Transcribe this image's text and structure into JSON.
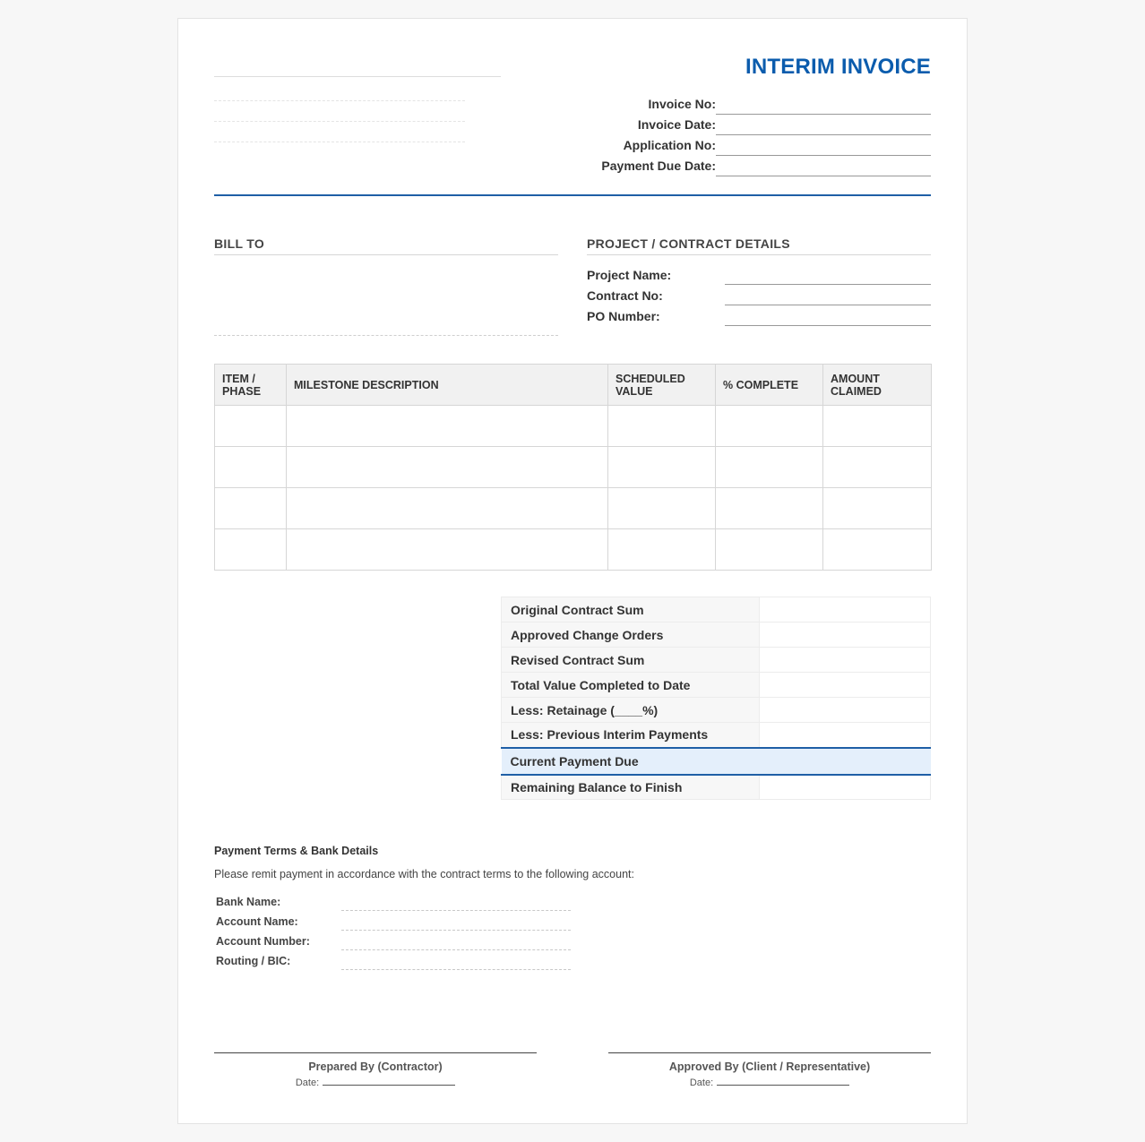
{
  "document": {
    "title": "INTERIM INVOICE"
  },
  "meta": {
    "fields": [
      {
        "label": "Invoice No:",
        "value": ""
      },
      {
        "label": "Invoice Date:",
        "value": ""
      },
      {
        "label": "Application No:",
        "value": ""
      },
      {
        "label": "Payment Due Date:",
        "value": ""
      }
    ]
  },
  "bill_to": {
    "heading": "BILL TO"
  },
  "project": {
    "heading": "PROJECT / CONTRACT DETAILS",
    "fields": [
      {
        "label": "Project Name:",
        "value": ""
      },
      {
        "label": "Contract No:",
        "value": ""
      },
      {
        "label": "PO Number:",
        "value": ""
      }
    ]
  },
  "milestones": {
    "columns": [
      "ITEM / PHASE",
      "MILESTONE DESCRIPTION",
      "SCHEDULED VALUE",
      "% COMPLETE",
      "AMOUNT CLAIMED"
    ],
    "rows": [
      [
        "",
        "",
        "",
        "",
        ""
      ],
      [
        "",
        "",
        "",
        "",
        ""
      ],
      [
        "",
        "",
        "",
        "",
        ""
      ],
      [
        "",
        "",
        "",
        "",
        ""
      ]
    ]
  },
  "summary": {
    "rows": [
      {
        "label": "Original Contract Sum",
        "value": ""
      },
      {
        "label": "Approved Change Orders",
        "value": ""
      },
      {
        "label": "Revised Contract Sum",
        "value": ""
      },
      {
        "label": "Total Value Completed to Date",
        "value": ""
      },
      {
        "label": "Less: Retainage (____%)",
        "value": ""
      },
      {
        "label": "Less: Previous Interim Payments",
        "value": ""
      },
      {
        "label": "Current Payment Due",
        "value": ""
      },
      {
        "label": "Remaining Balance to Finish",
        "value": ""
      }
    ]
  },
  "payment_terms": {
    "heading": "Payment Terms & Bank Details",
    "text": "Please remit payment in accordance with the contract terms to the following account:",
    "fields": [
      {
        "label": "Bank Name:",
        "value": ""
      },
      {
        "label": "Account Name:",
        "value": ""
      },
      {
        "label": "Account Number:",
        "value": ""
      },
      {
        "label": "Routing / BIC:",
        "value": ""
      }
    ]
  },
  "signatures": {
    "prepared_by": "Prepared By (Contractor)",
    "approved_by": "Approved By (Client / Representative)",
    "date_label": "Date:"
  },
  "colors": {
    "accent": "#0b5cad",
    "rule": "#1f5fa6",
    "highlight": "#e4effb"
  }
}
